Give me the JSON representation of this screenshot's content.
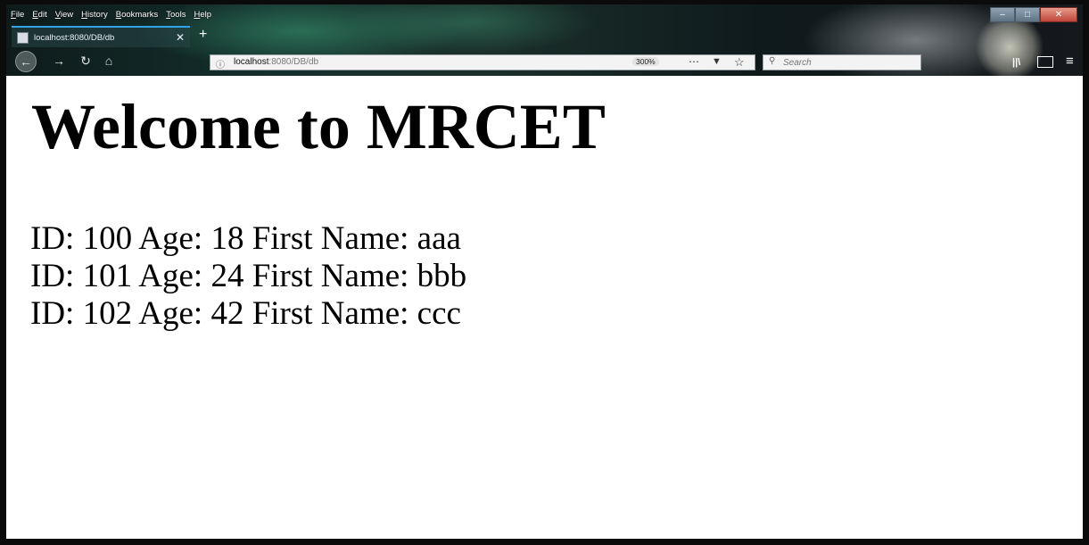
{
  "browser": {
    "menu": [
      "File",
      "Edit",
      "View",
      "History",
      "Bookmarks",
      "Tools",
      "Help"
    ],
    "tab": {
      "title": "localhost:8080/DB/db",
      "close_icon": "close-icon"
    },
    "window_controls": [
      "minimize",
      "maximize",
      "close"
    ],
    "new_tab_label": "+",
    "url": {
      "host": "localhost",
      "path": ":8080/DB/db"
    },
    "zoom": "300%",
    "search": {
      "placeholder": "Search",
      "value": ""
    }
  },
  "page": {
    "heading": "Welcome to MRCET",
    "records": [
      "ID: 100 Age: 18 First Name: aaa",
      "ID: 101 Age: 24 First Name: bbb",
      "ID: 102 Age: 42 First Name: ccc"
    ]
  },
  "colors": {
    "tab_accent": "#2fa4e7",
    "page_background": "#ffffff",
    "text": "#000000"
  }
}
